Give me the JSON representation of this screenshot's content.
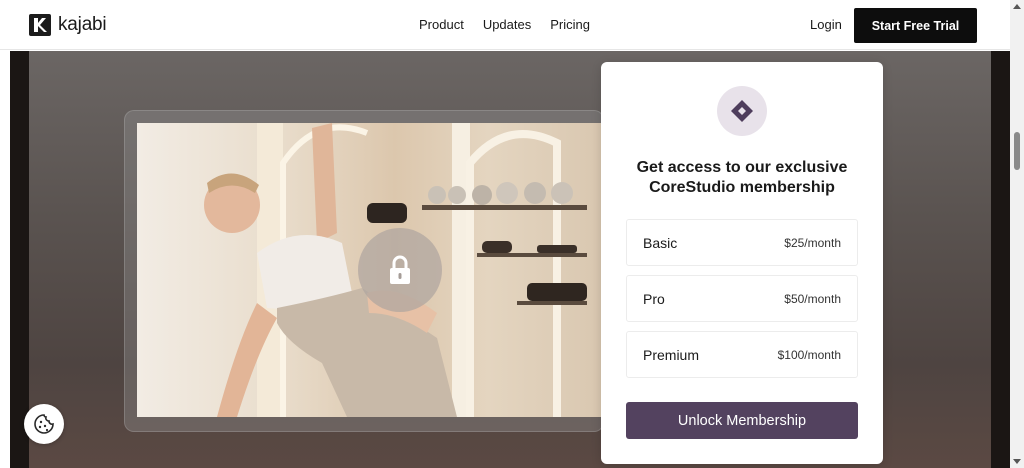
{
  "header": {
    "logo_text": "kajabi",
    "nav": [
      "Product",
      "Updates",
      "Pricing"
    ],
    "login_label": "Login",
    "cta_label": "Start Free Trial"
  },
  "card": {
    "title": "Get access to our exclusive CoreStudio membership",
    "plans": [
      {
        "name": "Basic",
        "price": "$25/month"
      },
      {
        "name": "Pro",
        "price": "$50/month"
      },
      {
        "name": "Premium",
        "price": "$100/month"
      }
    ],
    "unlock_label": "Unlock Membership"
  },
  "icons": {
    "logo": "kajabi-logo-icon",
    "badge": "diamond-icon",
    "lock": "lock-icon",
    "cookie": "cookie-icon"
  },
  "colors": {
    "accent": "#53425f",
    "cta": "#0d0d0d",
    "badge_bg": "#e8e2ea"
  }
}
